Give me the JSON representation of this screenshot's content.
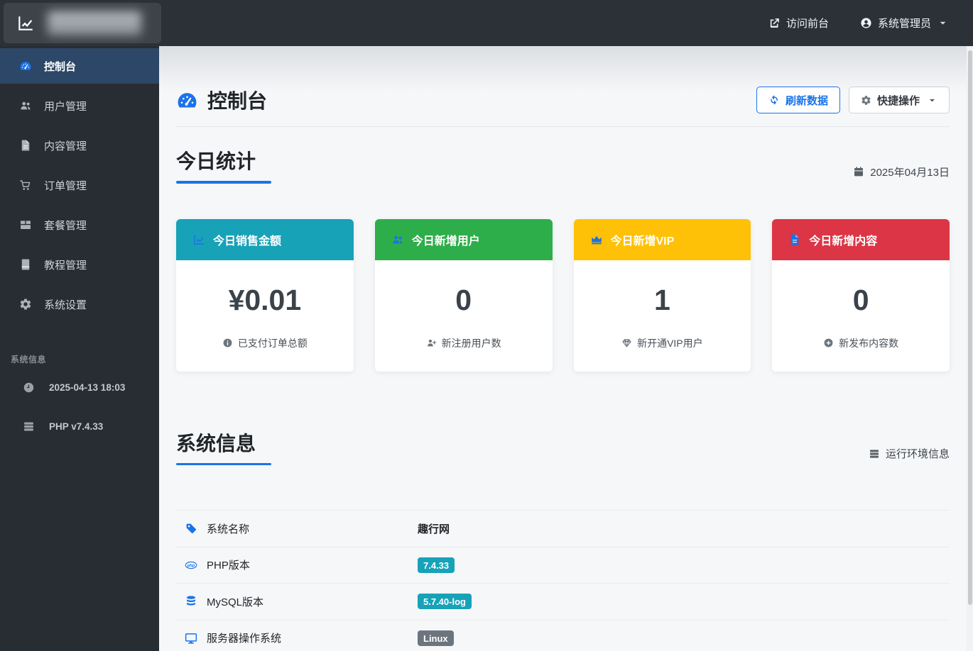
{
  "navbar": {
    "logo_icon": "chart-line-icon",
    "visit_site_label": "访问前台",
    "admin_label": "系统管理员"
  },
  "sidebar": {
    "items": [
      {
        "label": "控制台",
        "icon": "gauge-icon",
        "active": true
      },
      {
        "label": "用户管理",
        "icon": "users-icon",
        "active": false
      },
      {
        "label": "内容管理",
        "icon": "file-icon",
        "active": false
      },
      {
        "label": "订单管理",
        "icon": "cart-icon",
        "active": false
      },
      {
        "label": "套餐管理",
        "icon": "package-icon",
        "active": false
      },
      {
        "label": "教程管理",
        "icon": "book-icon",
        "active": false
      },
      {
        "label": "系统设置",
        "icon": "gear-icon",
        "active": false
      }
    ],
    "info_header": "系统信息",
    "info_items": [
      {
        "label": "2025-04-13 18:03",
        "icon": "clock-icon"
      },
      {
        "label": "PHP v7.4.33",
        "icon": "server-icon"
      }
    ]
  },
  "page": {
    "title": "控制台",
    "refresh_label": "刷新数据",
    "quick_actions_label": "快捷操作"
  },
  "today_stats": {
    "section_title": "今日统计",
    "date": "2025年04月13日",
    "cards": [
      {
        "title": "今日销售金额",
        "value": "¥0.01",
        "footer": "已支付订单总额",
        "header_color": "#17a2b8",
        "icon": "chart-line-icon",
        "footer_icon": "info-circle-icon"
      },
      {
        "title": "今日新增用户",
        "value": "0",
        "footer": "新注册用户数",
        "header_color": "#2eae4a",
        "icon": "users-icon",
        "footer_icon": "user-plus-icon"
      },
      {
        "title": "今日新增VIP",
        "value": "1",
        "footer": "新开通VIP用户",
        "header_color": "#ffc107",
        "icon": "crown-icon",
        "footer_icon": "gem-icon"
      },
      {
        "title": "今日新增内容",
        "value": "0",
        "footer": "新发布内容数",
        "header_color": "#dc3545",
        "icon": "file-icon",
        "footer_icon": "plus-circle-icon"
      }
    ]
  },
  "system_info": {
    "section_title": "系统信息",
    "subtitle": "运行环境信息",
    "subtitle_icon": "server-icon",
    "rows": [
      {
        "label": "系统名称",
        "icon": "tag-icon",
        "value": "趣行网",
        "value_style": "text"
      },
      {
        "label": "PHP版本",
        "icon": "php-icon",
        "value": "7.4.33",
        "value_style": "badge",
        "badge_color": "#17a2b8"
      },
      {
        "label": "MySQL版本",
        "icon": "database-icon",
        "value": "5.7.40-log",
        "value_style": "badge",
        "badge_color": "#17a2b8"
      },
      {
        "label": "服务器操作系统",
        "icon": "desktop-icon",
        "value": "Linux",
        "value_style": "badge",
        "badge_color": "#6c757d"
      }
    ]
  },
  "colors": {
    "primary_blue": "#1a73e8",
    "teal": "#17a2b8",
    "green": "#2eae4a",
    "yellow": "#ffc107",
    "red": "#dc3545",
    "badge_gray": "#6c757d",
    "navbar_bg": "#2c3137",
    "sidebar_bg": "#282d34",
    "active_item_bg": "#2c4767"
  }
}
